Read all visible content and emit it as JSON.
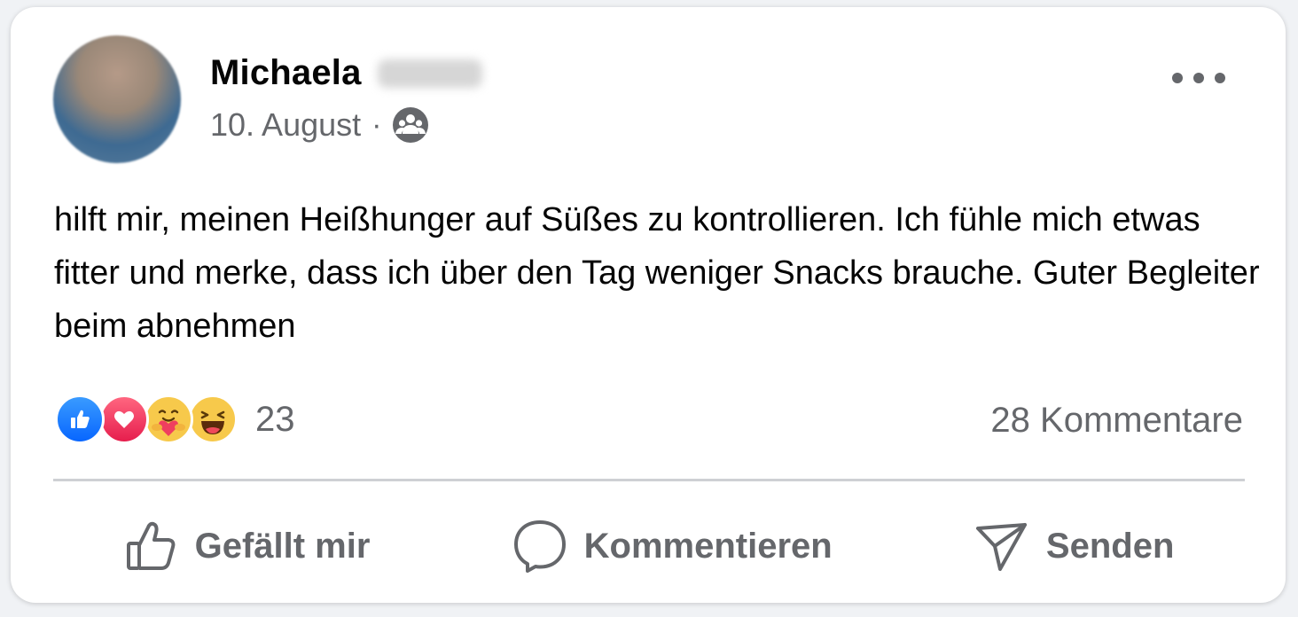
{
  "post": {
    "author_first_name": "Michaela",
    "date": "10. August",
    "separator": "·",
    "audience_icon": "friends-icon",
    "more_icon": "more-options-icon",
    "text": "hilft mir, meinen Heißhunger auf Süßes zu kontrollieren. Ich fühle mich etwas fitter und merke, dass ich über den Tag weniger Snacks brauche. Guter Begleiter beim abnehmen"
  },
  "stats": {
    "reactions": [
      "like",
      "love",
      "care",
      "haha"
    ],
    "reaction_count": "23",
    "comments_label": "28 Kommentare"
  },
  "actions": {
    "like_label": "Gefällt mir",
    "comment_label": "Kommentieren",
    "share_label": "Senden"
  },
  "colors": {
    "like_blue": "#0866ff",
    "love_red": "#e61e4d",
    "secondary_text": "#65676b",
    "primary_text": "#050505"
  }
}
